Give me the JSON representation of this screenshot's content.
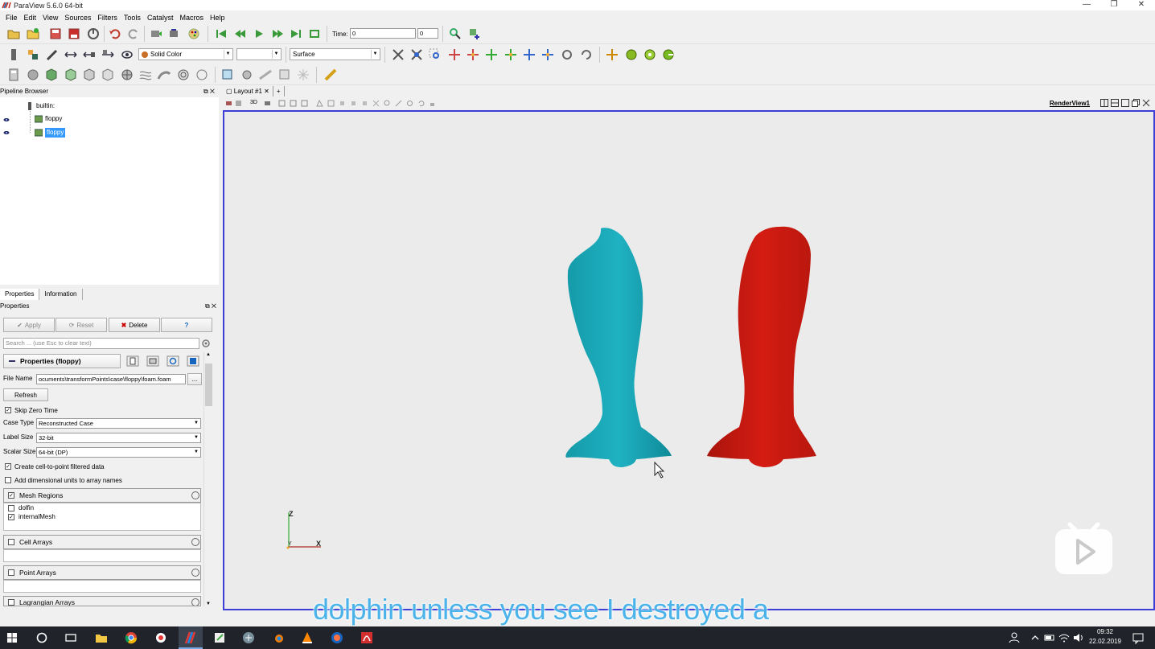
{
  "window": {
    "title": "ParaView 5.6.0 64-bit",
    "minimize": "—",
    "restore": "❐",
    "close": "✕"
  },
  "menu": [
    "File",
    "Edit",
    "View",
    "Sources",
    "Filters",
    "Tools",
    "Catalyst",
    "Macros",
    "Help"
  ],
  "time_toolbar": {
    "label": "Time:",
    "value": "0",
    "index": "0"
  },
  "display_toolbar": {
    "coloring": "Solid Color",
    "component": "",
    "representation": "Surface"
  },
  "pipeline": {
    "title": "Pipeline Browser",
    "root": "builtin:",
    "items": [
      {
        "label": "floppy",
        "visible": true,
        "selected": false
      },
      {
        "label": "floppy",
        "visible": true,
        "selected": true
      }
    ]
  },
  "panel_tabs": [
    "Properties",
    "Information"
  ],
  "properties": {
    "title": "Properties",
    "buttons": {
      "apply": "Apply",
      "reset": "Reset",
      "delete": "Delete",
      "help": "?"
    },
    "search_placeholder": "Search ... (use Esc to clear text)",
    "section_title": "Properties (floppy)",
    "file_name_label": "File Name",
    "file_name_value": "ocuments\\transformPoints\\case\\floppy\\foam.foam",
    "browse": "...",
    "refresh": "Refresh",
    "skip_zero_time": {
      "label": "Skip Zero Time",
      "checked": true
    },
    "case_type": {
      "label": "Case Type",
      "value": "Reconstructed Case"
    },
    "label_size": {
      "label": "Label Size",
      "value": "32-bit"
    },
    "scalar_size": {
      "label": "Scalar Size",
      "value": "64-bit (DP)"
    },
    "cell_to_point": {
      "label": "Create cell-to-point filtered data",
      "checked": true
    },
    "dim_units": {
      "label": "Add dimensional units to array names",
      "checked": false
    },
    "mesh_regions": {
      "label": "Mesh Regions",
      "checked": true,
      "items": [
        {
          "label": "dolfin",
          "checked": false
        },
        {
          "label": "internalMesh",
          "checked": true
        }
      ]
    },
    "cell_arrays": {
      "label": "Cell Arrays",
      "checked": false
    },
    "point_arrays": {
      "label": "Point Arrays",
      "checked": false
    },
    "lagrangian_arrays": {
      "label": "Lagrangian Arrays",
      "checked": false
    }
  },
  "layout": {
    "tab": "Layout #1",
    "add": "+",
    "view_name": "RenderView1",
    "mode_3d": "3D"
  },
  "axes": {
    "z": "Z",
    "y": "Y",
    "x": "X"
  },
  "colors": {
    "dolphin_left": "#1aa3b3",
    "dolphin_right": "#d01a10",
    "render_border": "#3d3dd8",
    "subtitle": "#4ab4ea"
  },
  "subtitle": "dolphin unless you see I destroyed a",
  "taskbar": {
    "time": "09:32",
    "date": "22.02.2019"
  }
}
